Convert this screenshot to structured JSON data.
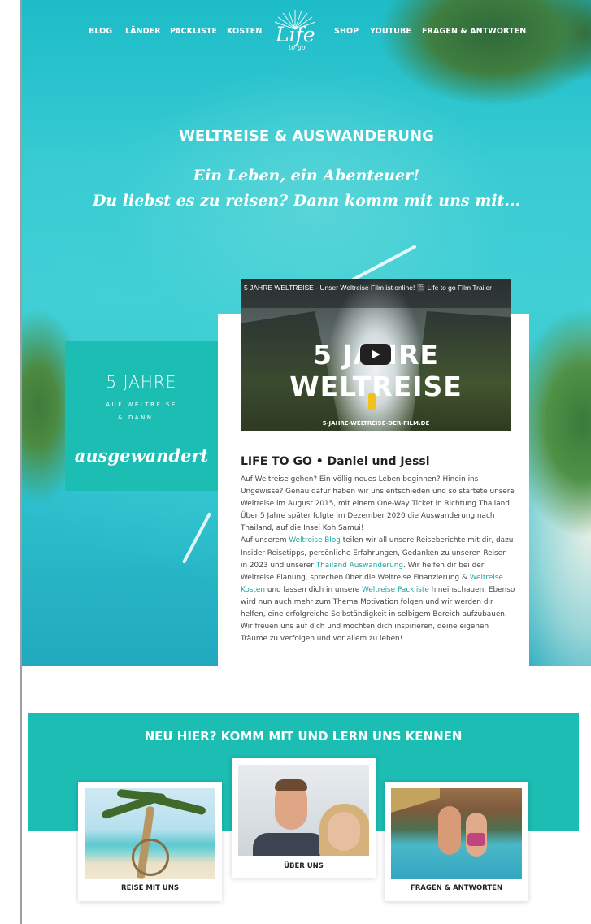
{
  "nav": {
    "left_items": [
      "BLOG",
      "LÄNDER",
      "PACKLISTE",
      "KOSTEN"
    ],
    "right_items": [
      "SHOP",
      "YOUTUBE",
      "FRAGEN & ANTWORTEN"
    ],
    "logo_text": "Life",
    "logo_sub": "to go"
  },
  "hero": {
    "title": "WELTREISE & AUSWANDERUNG",
    "script_line1": "Ein Leben, ein Abenteuer!",
    "script_line2": "Du liebst es zu reisen? Dann komm mit uns mit..."
  },
  "badge": {
    "big": "5 JAHRE",
    "small1": "AUF WELTREISE",
    "small2": "& DANN...",
    "script": "ausgewandert"
  },
  "video": {
    "title": "5 JAHRE WELTREISE - Unser Weltreise Film ist online! 🎬 Life to go Film Trailer",
    "big_text": "5 JAHRE WELTREISE",
    "url_text": "5-JAHRE-WELTREISE-DER-FILM.DE"
  },
  "intro": {
    "heading": "LIFE TO GO • Daniel und Jessi",
    "p1": "Auf Weltreise gehen? Ein völlig neues Leben beginnen? Hinein ins Ungewisse? Genau dafür haben wir uns entschieden und so startete unsere Weltreise im August 2015, mit einem One-Way Ticket in Richtung Thailand. Über 5 Jahre später folgte im Dezember 2020 die Auswanderung nach Thailand, auf die Insel Koh Samui!",
    "p2_a": "Auf unserem ",
    "link_blog": "Weltreise Blog",
    "p2_b": " teilen wir all unsere Reiseberichte mit dir, dazu Insider-Reisetipps, persönliche Erfahrungen, Gedanken zu unseren Reisen in 2023 und unserer ",
    "link_thailand": "Thailand Auswanderung",
    "p2_c": ". Wir helfen dir bei der Weltreise Planung, sprechen über die Weltreise Finanzierung & ",
    "link_kosten": "Weltreise Kosten",
    "p2_d": " und lassen dich in unsere ",
    "link_packliste": "Weltreise Packliste",
    "p2_e": " hineinschauen. Ebenso wird nun auch mehr zum Thema Motivation folgen und wir werden dir helfen, eine erfolgreiche Selbständigkeit in selbigem Bereich aufzubauen. Wir freuen uns auf dich und möchten dich inspirieren, deine eigenen Träume zu verfolgen und vor allem zu leben!"
  },
  "section": {
    "title": "NEU HIER? KOMM MIT UND LERN UNS KENNEN",
    "tiles": [
      {
        "label": "REISE MIT UNS"
      },
      {
        "label": "ÜBER UNS"
      },
      {
        "label": "FRAGEN & ANTWORTEN"
      }
    ]
  },
  "colors": {
    "accent_teal": "#1cbdb3",
    "link_teal": "#1aa3a0",
    "youtube_play": "#212121"
  }
}
